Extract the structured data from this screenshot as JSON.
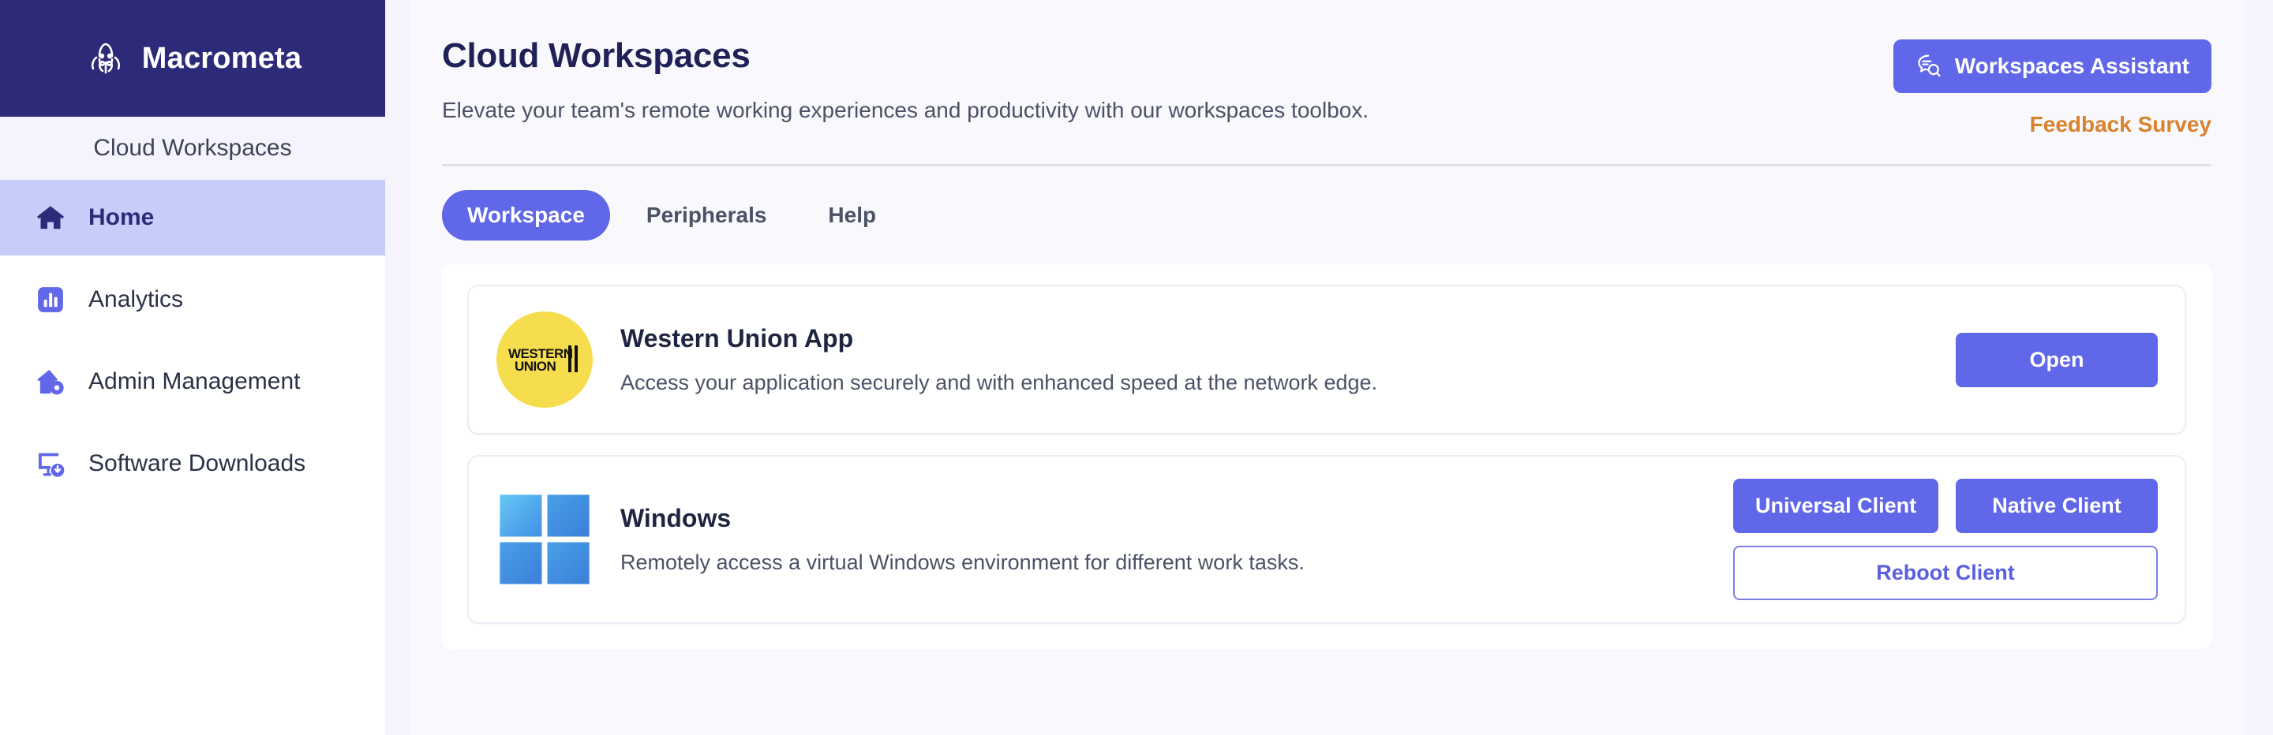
{
  "brand": {
    "name": "Macrometa",
    "logo_icon": "octopus-icon",
    "subtitle": "Cloud Workspaces"
  },
  "sidebar": {
    "items": [
      {
        "label": "Home",
        "icon": "home-icon",
        "active": true
      },
      {
        "label": "Analytics",
        "icon": "bar-chart-icon",
        "active": false
      },
      {
        "label": "Admin Management",
        "icon": "house-gear-icon",
        "active": false
      },
      {
        "label": "Software Downloads",
        "icon": "monitor-download-icon",
        "active": false
      }
    ]
  },
  "header": {
    "title": "Cloud Workspaces",
    "subtitle": "Elevate your team's remote working experiences and productivity with our workspaces toolbox.",
    "assistant_button": {
      "label": "Workspaces Assistant",
      "icon": "chat-search-icon",
      "color": "#6067e8"
    },
    "feedback_link": {
      "label": "Feedback Survey",
      "color": "#d9822b"
    }
  },
  "tabs": [
    {
      "label": "Workspace",
      "active": true
    },
    {
      "label": "Peripherals",
      "active": false
    },
    {
      "label": "Help",
      "active": false
    }
  ],
  "cards": [
    {
      "logo_icon": "western-union-logo",
      "logo_text": "WESTERN UNION",
      "title": "Western Union App",
      "description": "Access your application securely and with enhanced speed at the network edge.",
      "actions": [
        {
          "label": "Open",
          "style": "primary"
        }
      ]
    },
    {
      "logo_icon": "windows-logo",
      "title": "Windows",
      "description": "Remotely access a virtual Windows environment for different work tasks.",
      "actions": [
        {
          "label": "Universal Client",
          "style": "primary"
        },
        {
          "label": "Native Client",
          "style": "primary"
        },
        {
          "label": "Reboot Client",
          "style": "outline"
        }
      ]
    }
  ],
  "colors": {
    "brand_navy": "#2e2a7a",
    "accent_indigo": "#6067e8",
    "active_nav_bg": "#c6cdf9",
    "feedback_orange": "#d9822b",
    "page_bg": "#f9f8fd"
  }
}
